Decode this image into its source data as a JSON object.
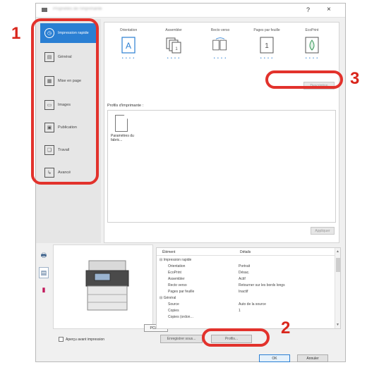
{
  "dialog": {
    "title": "Propriétés de l'imprimante",
    "help_glyph": "?",
    "close_glyph": "×"
  },
  "sidebar": {
    "items": [
      {
        "label": "Impression rapide",
        "icon": "clock-icon",
        "glyph": "◷"
      },
      {
        "label": "Général",
        "icon": "document-icon",
        "glyph": "▤"
      },
      {
        "label": "Mise en page",
        "icon": "layout-grid-icon",
        "glyph": "▦"
      },
      {
        "label": "Images",
        "icon": "image-icon",
        "glyph": "▭"
      },
      {
        "label": "Publication",
        "icon": "publication-icon",
        "glyph": "▣"
      },
      {
        "label": "Travail",
        "icon": "job-stack-icon",
        "glyph": "❏"
      },
      {
        "label": "Avancé",
        "icon": "advanced-arrow-icon",
        "glyph": "↳"
      }
    ]
  },
  "quick_print": {
    "settings": [
      {
        "label": "Orientation",
        "icon": "portrait-a-icon"
      },
      {
        "label": "Assembler",
        "icon": "collate-pages-icon"
      },
      {
        "label": "Recto verso",
        "icon": "duplex-icon"
      },
      {
        "label": "Pages par feuille",
        "icon": "pages-per-sheet-icon"
      },
      {
        "label": "EcoPrint",
        "icon": "ecoprint-drop-icon"
      }
    ],
    "dots": "• • • •",
    "description_button": "Description"
  },
  "profiles": {
    "label": "Profils d'imprimante :",
    "items": [
      {
        "name": "Paramètres du fabric..."
      }
    ],
    "apply_button": "Appliquer"
  },
  "preview": {
    "pdl_badge": "PCL XL",
    "show_preview_label": "Aperçu avant impression"
  },
  "details": {
    "col_element": "Élément",
    "col_details": "Détails",
    "rows": [
      {
        "key": "⊟ Impression rapide",
        "value": "",
        "indent": 0
      },
      {
        "key": "Orientation",
        "value": "Portrait",
        "indent": 1
      },
      {
        "key": "EcoPrint",
        "value": "Désac.",
        "indent": 1
      },
      {
        "key": "Assembler",
        "value": "Actif",
        "indent": 1
      },
      {
        "key": "Recto verso",
        "value": "Retourner sur les bords longs",
        "indent": 1
      },
      {
        "key": "Pages par feuille",
        "value": "Inactif",
        "indent": 1
      },
      {
        "key": "⊟ Général",
        "value": "",
        "indent": 0
      },
      {
        "key": "Source",
        "value": "Auto de la source",
        "indent": 1
      },
      {
        "key": "Copies",
        "value": "1",
        "indent": 1
      },
      {
        "key": "Copies (ordon…",
        "value": "",
        "indent": 1
      }
    ]
  },
  "buttons": {
    "save_as": "Enregistrer sous...",
    "profiles": "Profils...",
    "ok": "OK",
    "cancel": "Annuler"
  },
  "callouts": {
    "one": "1",
    "two": "2",
    "three": "3"
  },
  "colors": {
    "accent": "#2a7fd3",
    "callout_red": "#e2322c"
  }
}
